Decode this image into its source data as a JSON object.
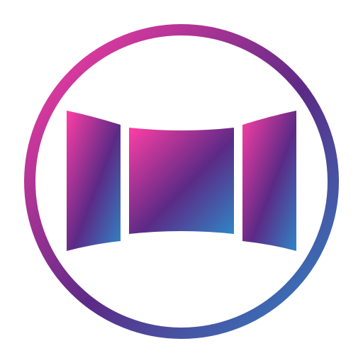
{
  "icon": {
    "name": "panorama-icon",
    "colors": {
      "background": "#ffffff",
      "gradient_start": "#ff3ea5",
      "gradient_mid": "#5b2a86",
      "gradient_end": "#2f86c6"
    }
  }
}
